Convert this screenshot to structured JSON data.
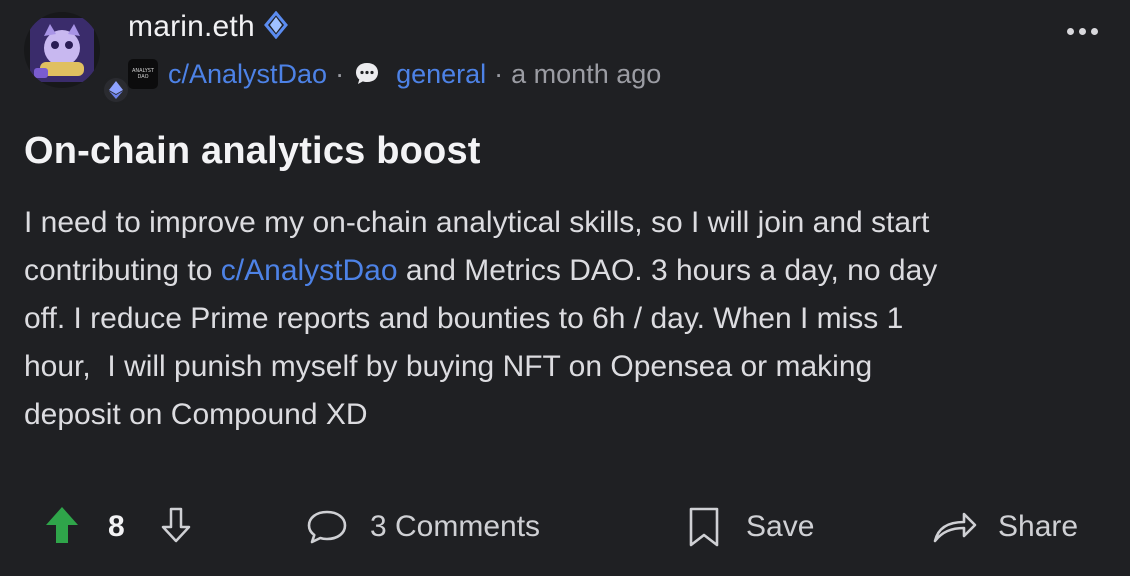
{
  "author": {
    "username": "marin.eth",
    "verified_icon": "ens-diamond-icon",
    "chain_badge": "ethereum-icon"
  },
  "meta": {
    "community": "c/AnalystDao",
    "community_logo_text": "ANALYST DAO",
    "separator": "·",
    "channel_icon": "chat-bubble-icon",
    "channel": "general",
    "time": "a month ago"
  },
  "post": {
    "title": "On-chain analytics boost",
    "body_part1": "I need to improve my on-chain analytical skills, so I will join and start\ncontributing to ",
    "body_link": "c/AnalystDao",
    "body_part2": " and Metrics DAO. 3 hours a day, no day\noff. I reduce Prime reports and bounties to 6h / day. When I miss 1\nhour,  I will punish myself by buying NFT on Opensea or making\ndeposit on Compound XD"
  },
  "actions": {
    "votes": "8",
    "comments": "3 Comments",
    "save": "Save",
    "share": "Share"
  },
  "colors": {
    "background": "#1f2023",
    "link": "#4d82e6",
    "upvote": "#2fa54a"
  }
}
